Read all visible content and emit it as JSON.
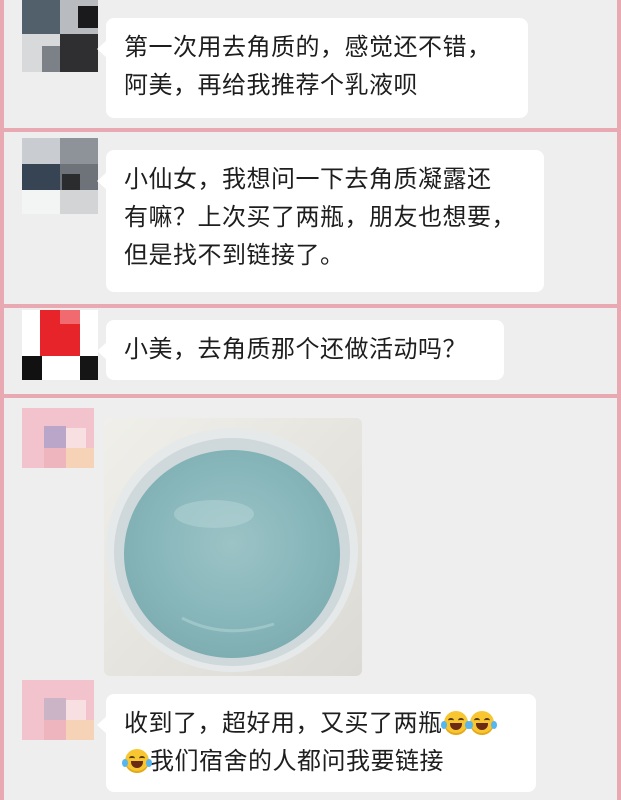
{
  "chat": {
    "messages": [
      {
        "sender": "user-1",
        "type": "text",
        "lines": [
          "第一次用去角质的，感觉还不错，",
          "阿美，再给我推荐个乳液呗"
        ]
      },
      {
        "sender": "user-2",
        "type": "text",
        "lines": [
          "小仙女，我想问一下去角质凝露还",
          "有嘛？上次买了两瓶，朋友也想要，",
          "但是找不到链接了。"
        ]
      },
      {
        "sender": "user-3",
        "type": "text",
        "lines": [
          "小美，去角质那个还做活动吗？"
        ]
      },
      {
        "sender": "user-4",
        "type": "image",
        "image": "photo of a round white container filled with translucent light-blue gel"
      },
      {
        "sender": "user-4",
        "type": "text",
        "line1": "收到了，超好用，又买了两瓶",
        "line2": "我们宿舍的人都问我要链接",
        "emoji": "face-with-tears-of-joy-icon"
      }
    ]
  },
  "colors": {
    "frame": "#e9a9b3",
    "chat_background": "#eeeeee",
    "bubble": "#ffffff",
    "text": "#1e1e1e"
  }
}
